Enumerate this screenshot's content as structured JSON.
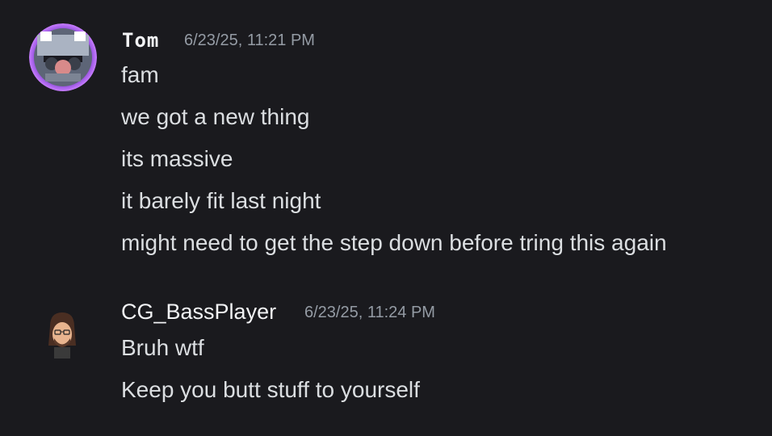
{
  "messages": [
    {
      "author": "Tom",
      "timestamp": "6/23/25, 11:21 PM",
      "avatar_icon": "raccoon-avatar-icon",
      "lines": [
        "fam",
        "we got a new thing",
        "its massive",
        "it barely fit last night",
        "might need to get the step down before tring this again"
      ]
    },
    {
      "author": "CG_BassPlayer",
      "timestamp": "6/23/25, 11:24 PM",
      "avatar_icon": "bearded-man-avatar-icon",
      "lines": [
        "Bruh wtf",
        "Keep you butt stuff to yourself"
      ]
    }
  ],
  "colors": {
    "background": "#1a1a1e",
    "username": "#f2f3f5",
    "timestamp": "#949ba4",
    "message_text": "#dbdee1",
    "avatar_ring": "#b45cff"
  }
}
